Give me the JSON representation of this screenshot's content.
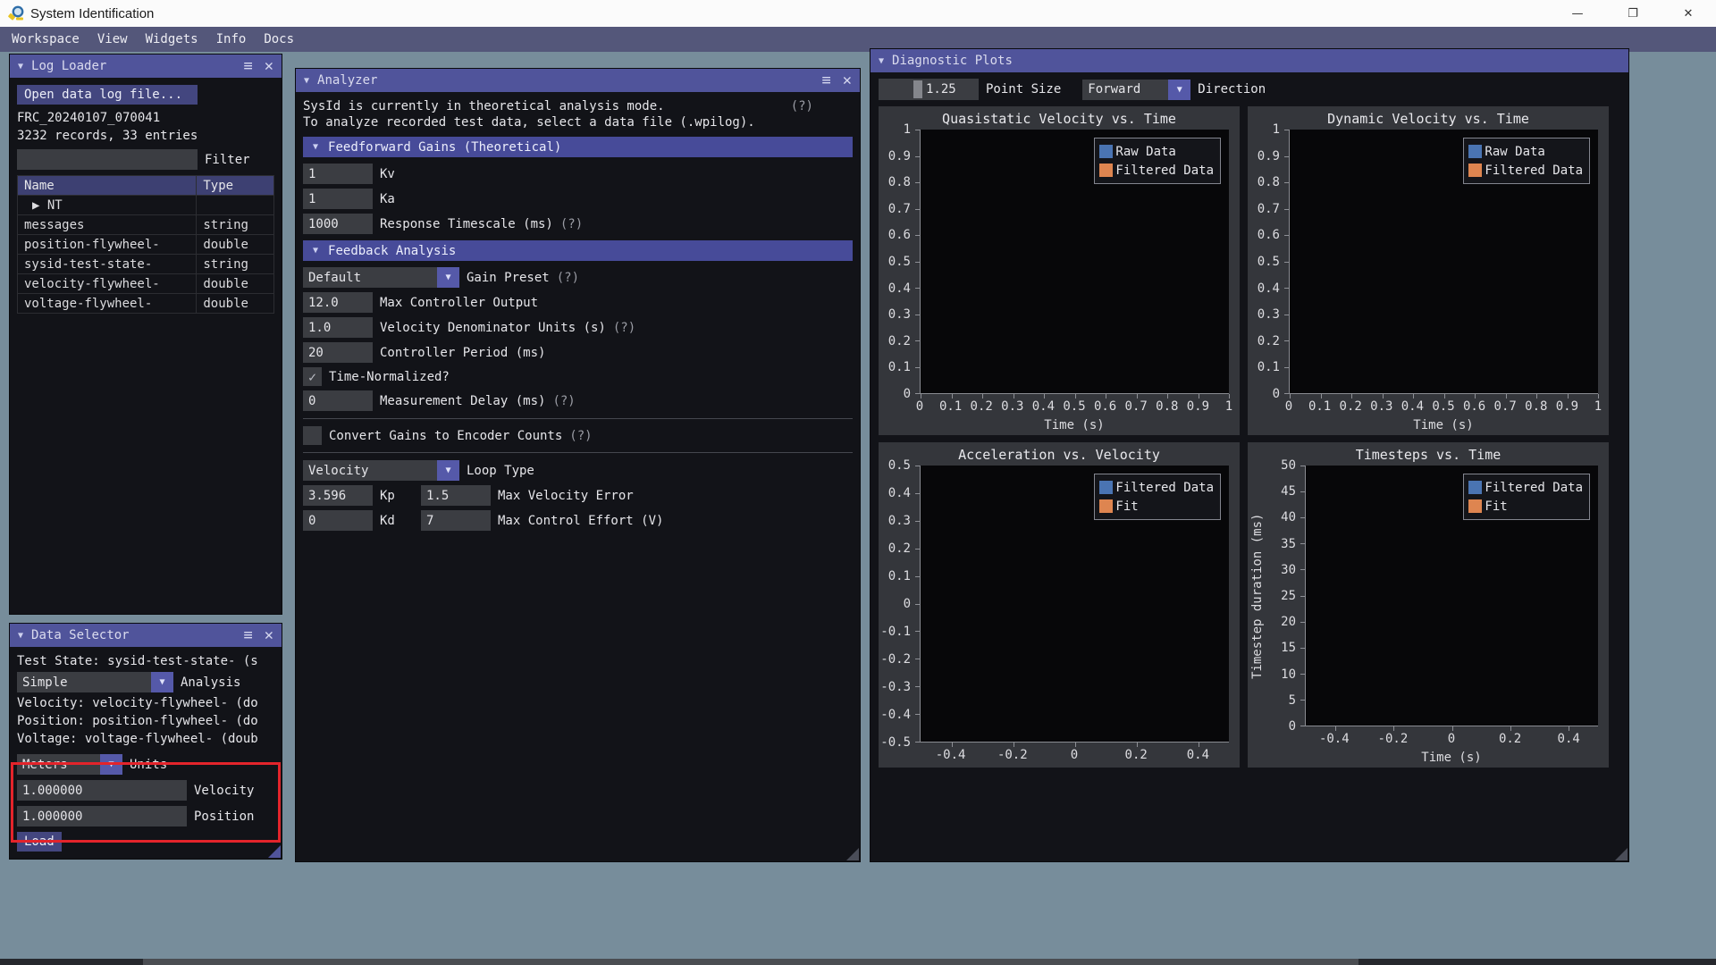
{
  "window": {
    "title": "System Identification",
    "controls": [
      {
        "name": "minimize",
        "glyph": "—"
      },
      {
        "name": "restore",
        "glyph": "❐"
      },
      {
        "name": "close",
        "glyph": "✕"
      }
    ]
  },
  "menu": {
    "items": [
      "Workspace",
      "View",
      "Widgets",
      "Info",
      "Docs"
    ]
  },
  "icons": {
    "collapse": "▼",
    "expand": "▶",
    "hamburger": "≡",
    "close": "✕",
    "check": "✓"
  },
  "colors": {
    "accent_indigo": "#50549b",
    "field_gray": "#3b3d42",
    "highlight_red": "#e3242b",
    "raw_blue": "#4a74b2",
    "filtered_orange": "#de8550",
    "desktop": "#778d9b"
  },
  "log_loader": {
    "title": "Log Loader",
    "open_button": "Open data log file...",
    "file_name": "FRC_20240107_070041",
    "summary": "3232 records, 33 entries",
    "filter_value": "",
    "filter_label": "Filter",
    "table": {
      "headers": [
        "Name",
        "Type"
      ],
      "rows": [
        {
          "name": "NT",
          "type": "",
          "expandable": true
        },
        {
          "name": "messages",
          "type": "string"
        },
        {
          "name": "position-flywheel-",
          "type": "double"
        },
        {
          "name": "sysid-test-state-",
          "type": "string"
        },
        {
          "name": "velocity-flywheel-",
          "type": "double"
        },
        {
          "name": "voltage-flywheel-",
          "type": "double"
        }
      ]
    }
  },
  "data_selector": {
    "title": "Data Selector",
    "test_state_line": "Test State: sysid-test-state- (s",
    "analysis_combo": {
      "value": "Simple",
      "label": "Analysis"
    },
    "velocity_line": "Velocity: velocity-flywheel- (do",
    "position_line": "Position: position-flywheel- (do",
    "voltage_line": "Voltage: voltage-flywheel- (doub",
    "units_combo": {
      "value": "Meters",
      "label": "Units"
    },
    "velocity_field": {
      "value": "1.000000",
      "label": "Velocity"
    },
    "position_field": {
      "value": "1.000000",
      "label": "Position"
    },
    "load_button": "Load"
  },
  "analyzer": {
    "title": "Analyzer",
    "mode_line1": "SysId is currently in theoretical analysis mode.",
    "mode_line1_help": "(?)",
    "mode_line2": "To analyze recorded test data, select a data file (.wpilog).",
    "feedforward": {
      "header": "Feedforward Gains (Theoretical)",
      "fields": [
        {
          "value": "1",
          "label": "Kv",
          "help": ""
        },
        {
          "value": "1",
          "label": "Ka",
          "help": ""
        },
        {
          "value": "1000",
          "label": "Response Timescale (ms)",
          "help": "(?)"
        }
      ]
    },
    "feedback": {
      "header": "Feedback Analysis",
      "gain_preset": {
        "value": "Default",
        "label": "Gain Preset",
        "help": "(?)"
      },
      "max_controller_output": {
        "value": "12.0",
        "label": "Max Controller Output",
        "help": ""
      },
      "velocity_denominator": {
        "value": "1.0",
        "label": "Velocity Denominator Units (s)",
        "help": "(?)"
      },
      "controller_period": {
        "value": "20",
        "label": "Controller Period (ms)",
        "help": ""
      },
      "time_normalized": {
        "checked": true,
        "label": "Time-Normalized?"
      },
      "measurement_delay": {
        "value": "0",
        "label": "Measurement Delay (ms)",
        "help": "(?)"
      },
      "convert_gains": {
        "checked": false,
        "label": "Convert Gains to Encoder Counts",
        "help": "(?)"
      },
      "loop_type": {
        "value": "Velocity",
        "label": "Loop Type"
      },
      "kp_row": {
        "value": "3.596",
        "label": "Kp",
        "value2": "1.5",
        "label2": "Max Velocity Error"
      },
      "kd_row": {
        "value": "0",
        "label": "Kd",
        "value2": "7",
        "label2": "Max Control Effort (V)"
      }
    }
  },
  "diagnostic_plots": {
    "title": "Diagnostic Plots",
    "point_size": {
      "value": "1.25",
      "label": "Point Size"
    },
    "direction": {
      "value": "Forward",
      "label": "Direction"
    }
  },
  "chart_data": [
    {
      "id": "quasistatic-velocity",
      "type": "scatter",
      "title": "Quasistatic Velocity vs. Time",
      "xlabel": "Time (s)",
      "ylabel": "",
      "xlim": [
        0,
        1
      ],
      "ylim": [
        0,
        1
      ],
      "xticks": [
        0,
        0.1,
        0.2,
        0.3,
        0.4,
        0.5,
        0.6,
        0.7,
        0.8,
        0.9,
        1
      ],
      "xtick_labels": [
        "0",
        "0.1",
        "0.2",
        "0.3",
        "0.4",
        "0.5",
        "0.6",
        "0.7",
        "0.8",
        "0.9",
        "1"
      ],
      "yticks": [
        1,
        0.9,
        0.8,
        0.7,
        0.6,
        0.5,
        0.4,
        0.3,
        0.2,
        0.1,
        0
      ],
      "ytick_labels": [
        "1",
        "0.9",
        "0.8",
        "0.7",
        "0.6",
        "0.5",
        "0.4",
        "0.3",
        "0.2",
        "0.1",
        "0"
      ],
      "grid": false,
      "legend_position": "top-right",
      "legend": [
        {
          "label": "Raw Data",
          "color": "#4a74b2"
        },
        {
          "label": "Filtered Data",
          "color": "#de8550"
        }
      ],
      "series": [
        {
          "name": "Raw Data",
          "points": []
        },
        {
          "name": "Filtered Data",
          "points": []
        }
      ]
    },
    {
      "id": "dynamic-velocity",
      "type": "scatter",
      "title": "Dynamic Velocity vs. Time",
      "xlabel": "Time (s)",
      "ylabel": "",
      "xlim": [
        0,
        1
      ],
      "ylim": [
        0,
        1
      ],
      "xticks": [
        0,
        0.1,
        0.2,
        0.3,
        0.4,
        0.5,
        0.6,
        0.7,
        0.8,
        0.9,
        1
      ],
      "xtick_labels": [
        "0",
        "0.1",
        "0.2",
        "0.3",
        "0.4",
        "0.5",
        "0.6",
        "0.7",
        "0.8",
        "0.9",
        "1"
      ],
      "yticks": [
        1,
        0.9,
        0.8,
        0.7,
        0.6,
        0.5,
        0.4,
        0.3,
        0.2,
        0.1,
        0
      ],
      "ytick_labels": [
        "1",
        "0.9",
        "0.8",
        "0.7",
        "0.6",
        "0.5",
        "0.4",
        "0.3",
        "0.2",
        "0.1",
        "0"
      ],
      "grid": false,
      "legend_position": "top-right",
      "legend": [
        {
          "label": "Raw Data",
          "color": "#4a74b2"
        },
        {
          "label": "Filtered Data",
          "color": "#de8550"
        }
      ],
      "series": [
        {
          "name": "Raw Data",
          "points": []
        },
        {
          "name": "Filtered Data",
          "points": []
        }
      ]
    },
    {
      "id": "acceleration-velocity",
      "type": "scatter",
      "title": "Acceleration vs. Velocity",
      "xlabel": "",
      "ylabel": "",
      "xlim": [
        -0.5,
        0.5
      ],
      "ylim": [
        -0.5,
        0.5
      ],
      "xticks": [
        -0.4,
        -0.2,
        0,
        0.2,
        0.4
      ],
      "xtick_labels": [
        "-0.4",
        "-0.2",
        "0",
        "0.2",
        "0.4"
      ],
      "yticks": [
        0.5,
        0.4,
        0.3,
        0.2,
        0.1,
        0,
        -0.1,
        -0.2,
        -0.3,
        -0.4,
        -0.5
      ],
      "ytick_labels": [
        "0.5",
        "0.4",
        "0.3",
        "0.2",
        "0.1",
        "0",
        "-0.1",
        "-0.2",
        "-0.3",
        "-0.4",
        "-0.5"
      ],
      "grid": false,
      "legend_position": "top-right",
      "legend": [
        {
          "label": "Filtered Data",
          "color": "#4a74b2"
        },
        {
          "label": "Fit",
          "color": "#de8550"
        }
      ],
      "series": [
        {
          "name": "Filtered Data",
          "points": []
        },
        {
          "name": "Fit",
          "points": []
        }
      ]
    },
    {
      "id": "timesteps-time",
      "type": "scatter",
      "title": "Timesteps vs. Time",
      "xlabel": "Time (s)",
      "ylabel": "Timestep duration (ms)",
      "xlim": [
        -0.5,
        0.5
      ],
      "ylim": [
        0,
        50
      ],
      "xticks": [
        -0.4,
        -0.2,
        0,
        0.2,
        0.4
      ],
      "xtick_labels": [
        "-0.4",
        "-0.2",
        "0",
        "0.2",
        "0.4"
      ],
      "yticks": [
        50,
        45,
        40,
        35,
        30,
        25,
        20,
        15,
        10,
        5,
        0
      ],
      "ytick_labels": [
        "50",
        "45",
        "40",
        "35",
        "30",
        "25",
        "20",
        "15",
        "10",
        "5",
        "0"
      ],
      "grid": false,
      "legend_position": "top-right",
      "legend": [
        {
          "label": "Filtered Data",
          "color": "#4a74b2"
        },
        {
          "label": "Fit",
          "color": "#de8550"
        }
      ],
      "series": [
        {
          "name": "Filtered Data",
          "points": []
        },
        {
          "name": "Fit",
          "points": []
        }
      ]
    }
  ]
}
